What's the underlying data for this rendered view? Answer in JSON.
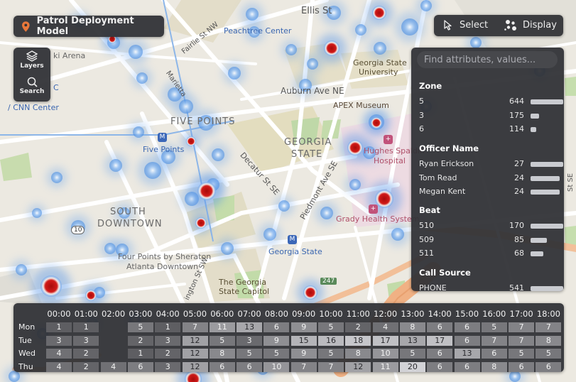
{
  "title": "Patrol Deployment Model",
  "toolbar": {
    "layers_label": "Layers",
    "search_label": "Search"
  },
  "topbar": {
    "select_label": "Select",
    "display_label": "Display"
  },
  "colors": {
    "panel": "#303135",
    "accent_pin": "#e8773a",
    "hotspot_red": "#c41616",
    "hotspot_blue": "#4f93e6",
    "poi_blue": "#3b67b8"
  },
  "map_labels": {
    "ellis_st": "Ellis St",
    "peachtree_center": "Peachtree Center",
    "fairlie_st": "Fairlie St NW",
    "marietta_st": "Marietta",
    "georgia_state_univ_1": "Georgia State",
    "georgia_state_univ_2": "University",
    "auburn_ave": "Auburn Ave NE",
    "apex_museum": "APEX Museum",
    "cnn_1": "C",
    "cnn_2": "ki Arena",
    "cnn_3": "/ CNN Center",
    "five_points_hood": "FIVE POINTS",
    "five_points_station": "Five Points",
    "georgia_state_hood_1": "GEORGIA",
    "georgia_state_hood_2": "STATE",
    "decatur_st": "Decatur St SE",
    "piedmont_ave": "Piedmont Ave SE",
    "hughes_spalding_1": "Hughes Spaldin",
    "hughes_spalding_2": "Hospital",
    "south_downtown_1": "SOUTH",
    "south_downtown_2": "DOWNTOWN",
    "grady": "Grady Health System",
    "four_points_1": "Four Points by Sheraton",
    "four_points_2": "Atlanta Downtown",
    "georgia_state_station": "Georgia State",
    "georgia_capitol_1": "The Georgia",
    "georgia_capitol_2": "State Capitol",
    "washington_st": "ington St SW",
    "shield_247": "247",
    "shield_10": "10",
    "right_st": "St SE",
    "poi_m": "M",
    "poi_h": "+"
  },
  "attributes": {
    "search_placeholder": "Find attributes, values...",
    "zone": {
      "title": "Zone",
      "rows": [
        {
          "label": "5",
          "count": "644",
          "frac": 1.0
        },
        {
          "label": "3",
          "count": "175",
          "frac": 0.27
        },
        {
          "label": "6",
          "count": "114",
          "frac": 0.18
        }
      ]
    },
    "officer": {
      "title": "Officer Name",
      "rows": [
        {
          "label": "Ryan Erickson",
          "count": "27",
          "frac": 1.0
        },
        {
          "label": "Tom Read",
          "count": "24",
          "frac": 0.89
        },
        {
          "label": "Megan Kent",
          "count": "24",
          "frac": 0.89
        }
      ]
    },
    "beat": {
      "title": "Beat",
      "rows": [
        {
          "label": "510",
          "count": "170",
          "frac": 1.0
        },
        {
          "label": "509",
          "count": "85",
          "frac": 0.5
        },
        {
          "label": "511",
          "count": "68",
          "frac": 0.4
        }
      ]
    },
    "call_source": {
      "title": "Call Source",
      "rows": [
        {
          "label": "PHONE",
          "count": "541",
          "frac": 1.0
        }
      ]
    }
  },
  "timeline": {
    "hours": [
      "00:00",
      "01:00",
      "02:00",
      "03:00",
      "04:00",
      "05:00",
      "06:00",
      "07:00",
      "08:00",
      "09:00",
      "10:00",
      "11:00",
      "12:00",
      "13:00",
      "14:00",
      "15:00",
      "16:00",
      "17:00",
      "18:00"
    ],
    "days": [
      "Mon",
      "Tue",
      "Wed",
      "Thu"
    ],
    "values": [
      [
        "1",
        "1",
        "",
        "5",
        "1",
        "7",
        "11",
        "13",
        "6",
        "9",
        "5",
        "2",
        "4",
        "8",
        "6",
        "6",
        "5",
        "7",
        "7"
      ],
      [
        "3",
        "3",
        "",
        "2",
        "3",
        "12",
        "5",
        "3",
        "9",
        "15",
        "16",
        "18",
        "17",
        "13",
        "17",
        "6",
        "7",
        "7",
        "8"
      ],
      [
        "4",
        "2",
        "",
        "1",
        "2",
        "12",
        "8",
        "5",
        "5",
        "9",
        "5",
        "8",
        "10",
        "5",
        "6",
        "13",
        "6",
        "5",
        "5"
      ],
      [
        "4",
        "2",
        "4",
        "6",
        "3",
        "12",
        "6",
        "6",
        "10",
        "7",
        "7",
        "12",
        "11",
        "20",
        "6",
        "6",
        "8",
        "6",
        "6"
      ]
    ]
  }
}
